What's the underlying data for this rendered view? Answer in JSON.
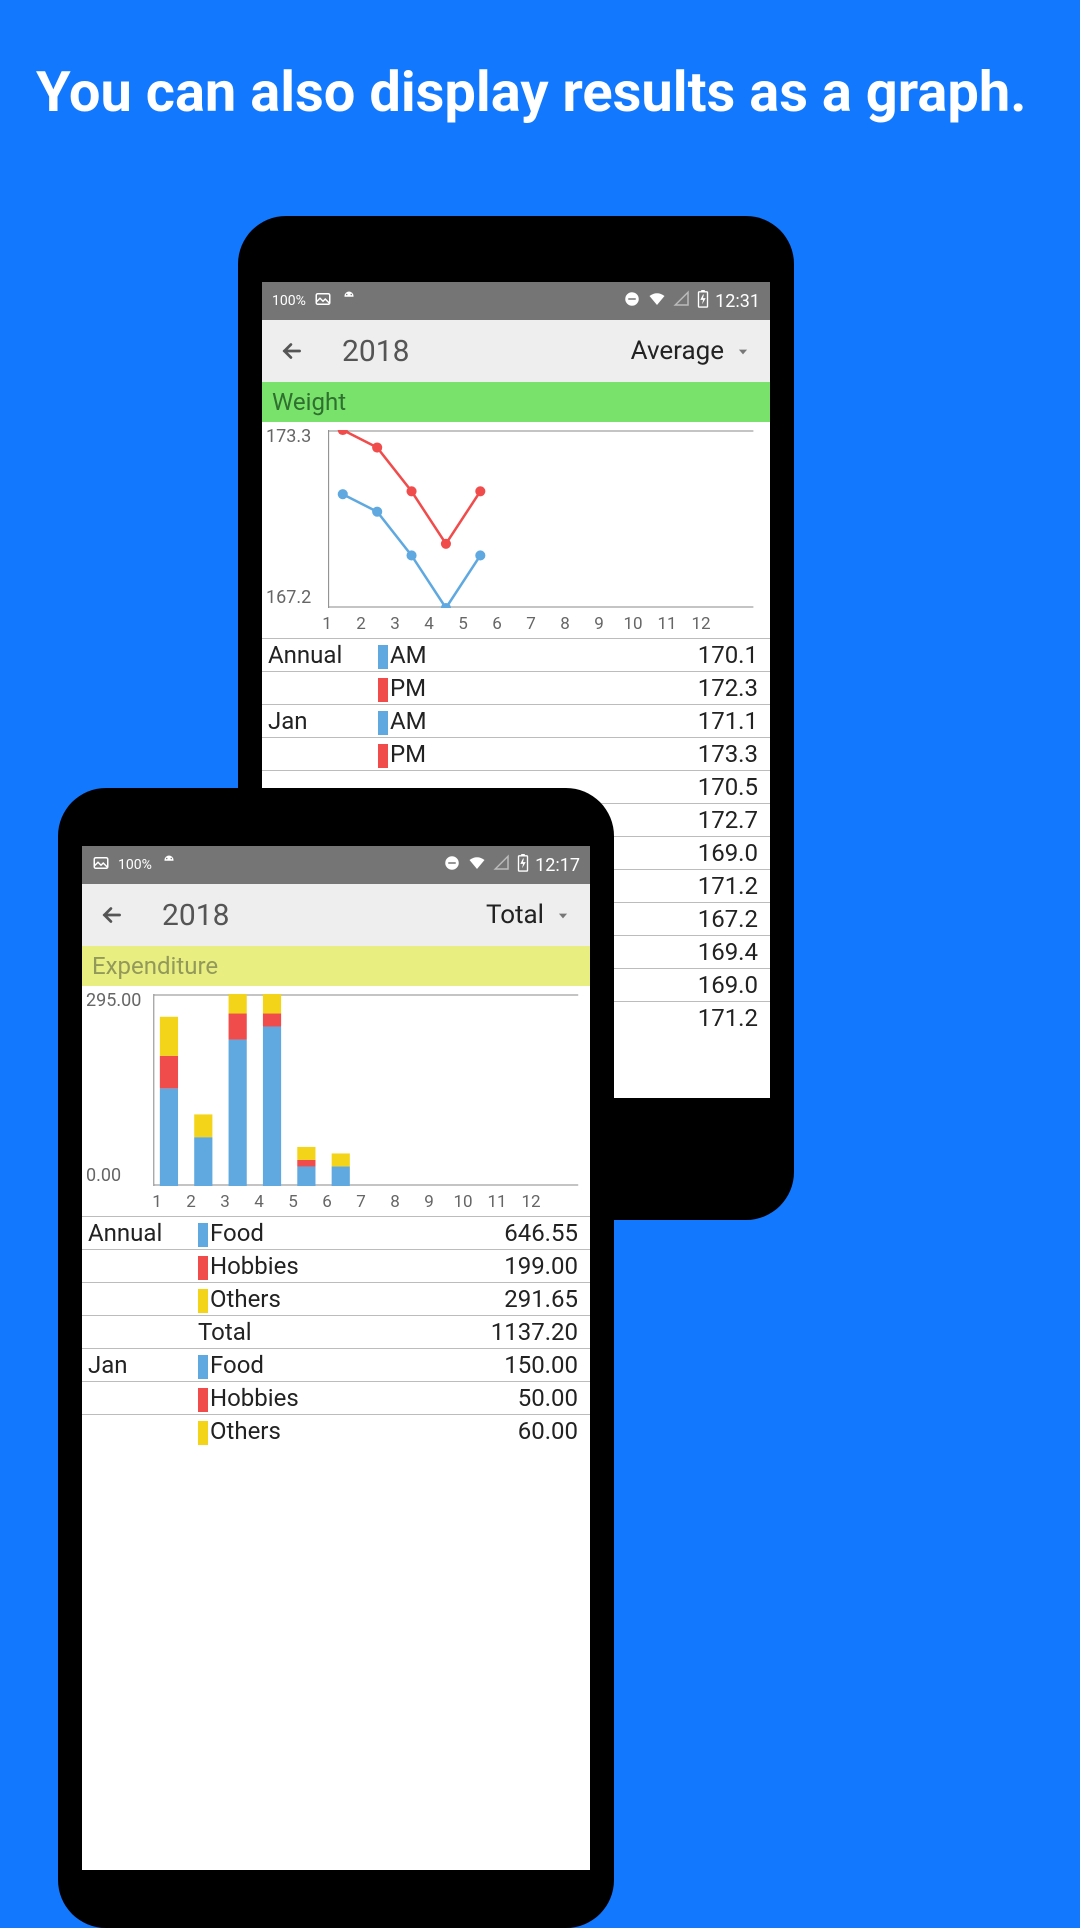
{
  "headline": "You can also display results as a graph.",
  "phone_back": {
    "status": {
      "battery": "100%",
      "time": "12:31"
    },
    "appbar": {
      "year": "2018",
      "mode": "Average"
    },
    "section_label": "Weight",
    "chart_ymax_label": "173.3",
    "chart_ymin_label": "167.2",
    "months": [
      "1",
      "2",
      "3",
      "4",
      "5",
      "6",
      "7",
      "8",
      "9",
      "10",
      "11",
      "12"
    ],
    "table_rows": [
      {
        "group": "Annual",
        "legend": "AM",
        "color": "#5fa9e0",
        "value": "170.1"
      },
      {
        "group": "",
        "legend": "PM",
        "color": "#f04c4c",
        "value": "172.3"
      },
      {
        "group": "Jan",
        "legend": "AM",
        "color": "#5fa9e0",
        "value": "171.1"
      },
      {
        "group": "",
        "legend": "PM",
        "color": "#f04c4c",
        "value": "173.3"
      },
      {
        "group": "",
        "legend": "",
        "color": "",
        "value": "170.5"
      },
      {
        "group": "",
        "legend": "",
        "color": "",
        "value": "172.7"
      },
      {
        "group": "",
        "legend": "",
        "color": "",
        "value": "169.0"
      },
      {
        "group": "",
        "legend": "",
        "color": "",
        "value": "171.2"
      },
      {
        "group": "",
        "legend": "",
        "color": "",
        "value": "167.2"
      },
      {
        "group": "",
        "legend": "",
        "color": "",
        "value": "169.4"
      },
      {
        "group": "",
        "legend": "",
        "color": "",
        "value": "169.0"
      },
      {
        "group": "",
        "legend": "",
        "color": "",
        "value": "171.2"
      }
    ]
  },
  "phone_front": {
    "status": {
      "battery": "100%",
      "time": "12:17"
    },
    "appbar": {
      "year": "2018",
      "mode": "Total"
    },
    "section_label": "Expenditure",
    "chart_ymax_label": "295.00",
    "chart_ymin_label": "0.00",
    "months": [
      "1",
      "2",
      "3",
      "4",
      "5",
      "6",
      "7",
      "8",
      "9",
      "10",
      "11",
      "12"
    ],
    "table_rows": [
      {
        "group": "Annual",
        "legend": "Food",
        "color": "#5fa9e0",
        "value": "646.55"
      },
      {
        "group": "",
        "legend": "Hobbies",
        "color": "#f04c4c",
        "value": "199.00"
      },
      {
        "group": "",
        "legend": "Others",
        "color": "#f4d419",
        "value": "291.65"
      },
      {
        "group": "",
        "legend": "Total",
        "color": "",
        "value": "1137.20"
      },
      {
        "group": "Jan",
        "legend": "Food",
        "color": "#5fa9e0",
        "value": "150.00"
      },
      {
        "group": "",
        "legend": "Hobbies",
        "color": "#f04c4c",
        "value": "50.00"
      },
      {
        "group": "",
        "legend": "Others",
        "color": "#f4d419",
        "value": "60.00"
      }
    ]
  },
  "chart_data": [
    {
      "type": "line",
      "title": "Weight",
      "xlabel": "",
      "ylabel": "",
      "ylim": [
        167.2,
        173.3
      ],
      "x": [
        1,
        2,
        3,
        4,
        5,
        6
      ],
      "series": [
        {
          "name": "PM",
          "color": "#f04c4c",
          "values": [
            173.3,
            172.7,
            171.2,
            169.4,
            171.2,
            null
          ]
        },
        {
          "name": "AM",
          "color": "#5fa9e0",
          "values": [
            171.1,
            170.5,
            169.0,
            167.2,
            169.0,
            null
          ]
        }
      ]
    },
    {
      "type": "bar",
      "title": "Expenditure",
      "xlabel": "",
      "ylabel": "",
      "ylim": [
        0,
        295
      ],
      "categories": [
        "1",
        "2",
        "3",
        "4",
        "5",
        "6",
        "7",
        "8",
        "9",
        "10",
        "11",
        "12"
      ],
      "series": [
        {
          "name": "Food",
          "color": "#5fa9e0",
          "values": [
            150,
            75,
            225,
            245,
            30,
            30,
            0,
            0,
            0,
            0,
            0,
            0
          ]
        },
        {
          "name": "Hobbies",
          "color": "#f04c4c",
          "values": [
            50,
            0,
            40,
            20,
            10,
            0,
            0,
            0,
            0,
            0,
            0,
            0
          ]
        },
        {
          "name": "Others",
          "color": "#f4d419",
          "values": [
            60,
            35,
            30,
            30,
            20,
            20,
            0,
            0,
            0,
            0,
            0,
            0
          ]
        }
      ]
    }
  ]
}
